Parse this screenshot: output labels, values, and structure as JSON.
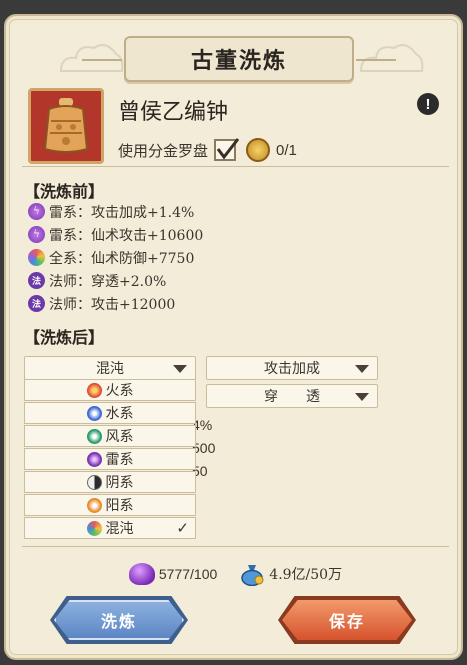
{
  "title": "古董洗炼",
  "item": {
    "name": "曾侯乙编钟",
    "info_icon": "exclamation-icon"
  },
  "use_option": {
    "label": "使用分金罗盘",
    "checked": true,
    "count": "0/1"
  },
  "before": {
    "heading": "【洗炼前】",
    "stats": [
      {
        "icon": "thunder-icon",
        "text": "雷系：攻击加成+1.4%"
      },
      {
        "icon": "thunder-icon",
        "text": "雷系：仙术攻击+10600"
      },
      {
        "icon": "all-element-icon",
        "text": "全系：仙术防御+7750"
      },
      {
        "icon": "fa-icon",
        "icon_text": "法",
        "text": "法师：穿透+2.0%"
      },
      {
        "icon": "fa-icon",
        "icon_text": "法",
        "text": "法师：攻击+12000"
      }
    ]
  },
  "after": {
    "heading": "【洗炼后】",
    "dropdown_element": "混沌",
    "dropdown_attr1": "攻击加成",
    "dropdown_attr2": "穿　　透",
    "hidden_partial": [
      "4%",
      "500",
      "50"
    ]
  },
  "element_menu": [
    {
      "icon": "fire-icon",
      "label": "火系",
      "selected": false
    },
    {
      "icon": "water-icon",
      "label": "水系",
      "selected": false
    },
    {
      "icon": "wind-icon",
      "label": "风系",
      "selected": false
    },
    {
      "icon": "thunder-icon",
      "label": "雷系",
      "selected": false
    },
    {
      "icon": "yin-icon",
      "label": "阴系",
      "selected": false
    },
    {
      "icon": "yang-icon",
      "label": "阳系",
      "selected": false
    },
    {
      "icon": "chaos-icon",
      "label": "混沌",
      "selected": true,
      "check": "✓"
    }
  ],
  "resources": {
    "gem": {
      "icon": "purple-gem-icon",
      "value": "5777/100"
    },
    "money": {
      "icon": "money-bag-icon",
      "value": "4.9亿/50万"
    }
  },
  "buttons": {
    "wash": "洗炼",
    "save": "保存"
  },
  "colors": {
    "panel_bg": "#f2ecd9",
    "wash_button": "#6a92cc",
    "save_button": "#e06a3e",
    "item_frame": "#b2362a"
  }
}
